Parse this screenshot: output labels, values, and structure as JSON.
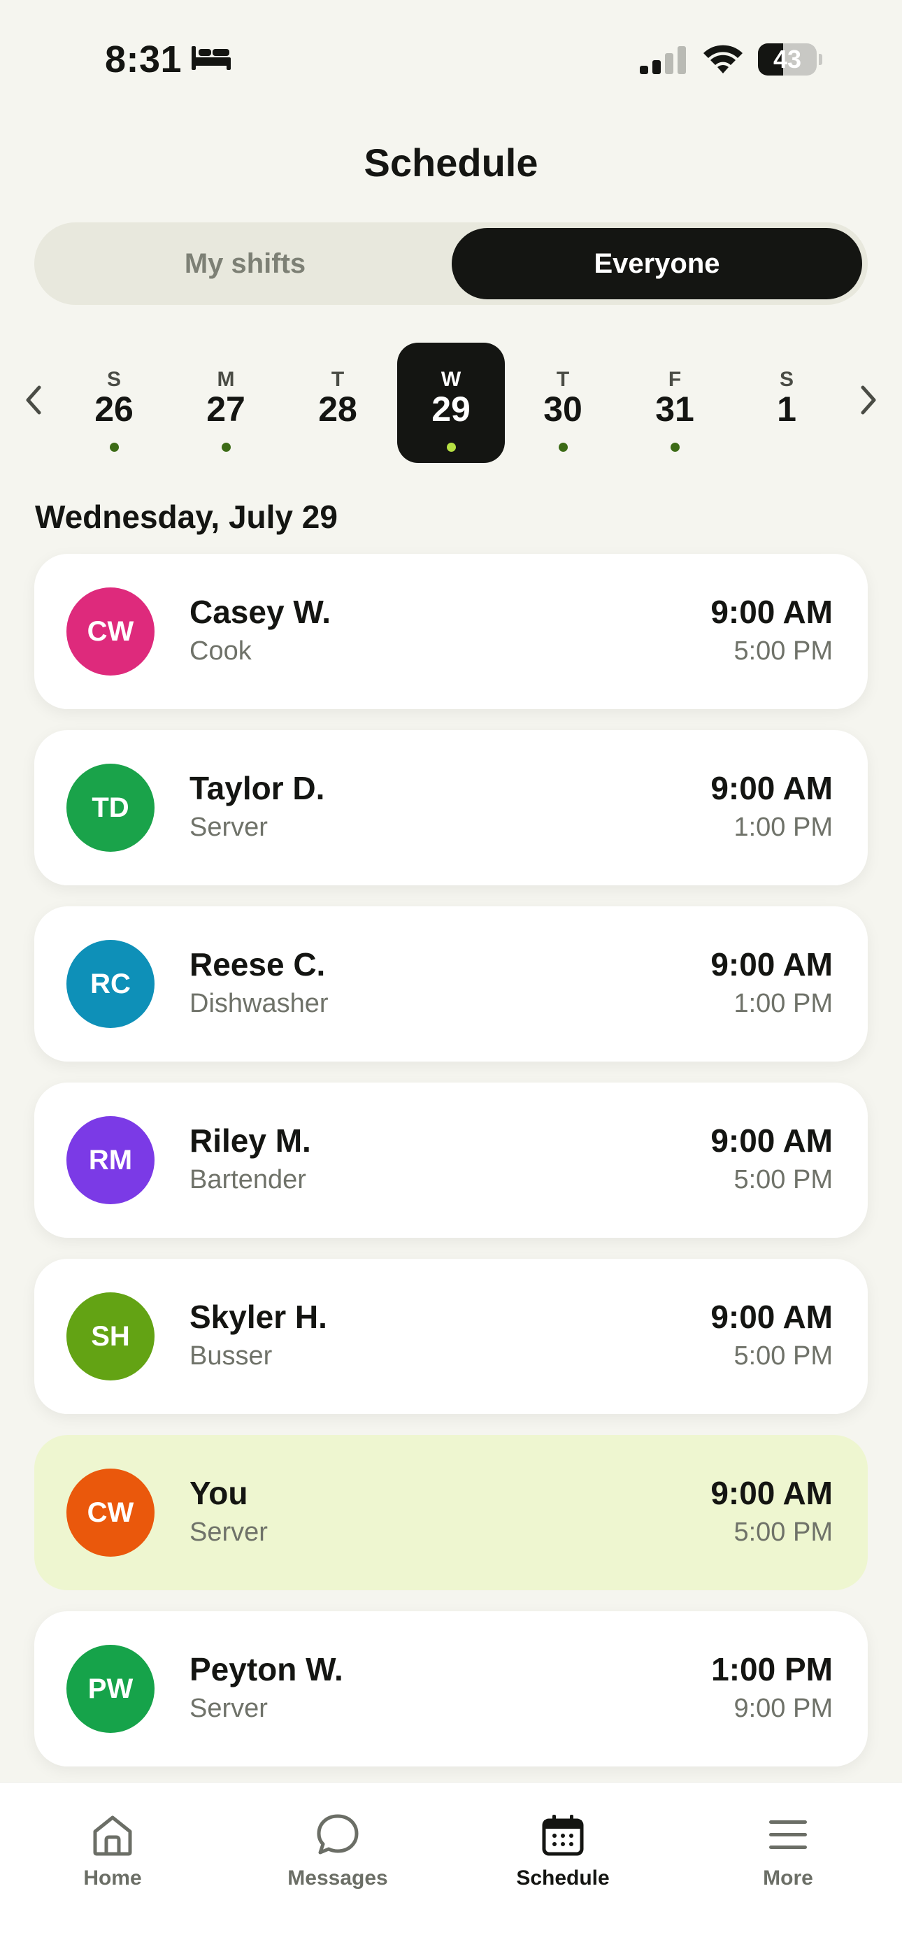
{
  "status_bar": {
    "time": "8:31",
    "battery": "43",
    "battery_level": 0.43
  },
  "header": {
    "title": "Schedule"
  },
  "segmented": {
    "my_shifts": "My shifts",
    "everyone": "Everyone",
    "selected": "Everyone"
  },
  "week": {
    "days": [
      {
        "dow": "S",
        "num": "26",
        "has_shift": true
      },
      {
        "dow": "M",
        "num": "27",
        "has_shift": true
      },
      {
        "dow": "T",
        "num": "28",
        "has_shift": false
      },
      {
        "dow": "W",
        "num": "29",
        "has_shift": true,
        "selected": true
      },
      {
        "dow": "T",
        "num": "30",
        "has_shift": true
      },
      {
        "dow": "F",
        "num": "31",
        "has_shift": true
      },
      {
        "dow": "S",
        "num": "1",
        "has_shift": false
      }
    ]
  },
  "date_heading": "Wednesday, July 29",
  "shifts": [
    {
      "initials": "CW",
      "name": "Casey W.",
      "role": "Cook",
      "start": "9:00 AM",
      "end": "5:00 PM",
      "color": "#de2a7c"
    },
    {
      "initials": "TD",
      "name": "Taylor D.",
      "role": "Server",
      "start": "9:00 AM",
      "end": "1:00 PM",
      "color": "#1aa34a"
    },
    {
      "initials": "RC",
      "name": "Reese C.",
      "role": "Dishwasher",
      "start": "9:00 AM",
      "end": "1:00 PM",
      "color": "#0e90b8"
    },
    {
      "initials": "RM",
      "name": "Riley M.",
      "role": "Bartender",
      "start": "9:00 AM",
      "end": "5:00 PM",
      "color": "#7b3ae6"
    },
    {
      "initials": "SH",
      "name": "Skyler H.",
      "role": "Busser",
      "start": "9:00 AM",
      "end": "5:00 PM",
      "color": "#63a314"
    },
    {
      "initials": "CW",
      "name": "You",
      "role": "Server",
      "start": "9:00 AM",
      "end": "5:00 PM",
      "color": "#ea580c",
      "is_me": true
    },
    {
      "initials": "PW",
      "name": "Peyton W.",
      "role": "Server",
      "start": "1:00 PM",
      "end": "9:00 PM",
      "color": "#16a34a"
    }
  ],
  "tab_bar": {
    "items": [
      {
        "label": "Home",
        "icon": "home-icon"
      },
      {
        "label": "Messages",
        "icon": "chat-bubble-icon"
      },
      {
        "label": "Schedule",
        "icon": "calendar-icon",
        "active": true
      },
      {
        "label": "More",
        "icon": "menu-icon"
      }
    ]
  },
  "colors": {
    "accent_dark": "#141512",
    "highlight": "#eef6d0",
    "dot": "#3c6b16",
    "dot_selected": "#b6e043"
  }
}
